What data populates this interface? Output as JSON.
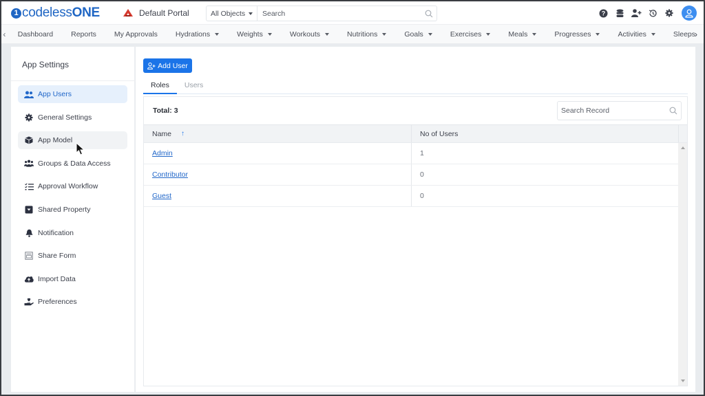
{
  "header": {
    "brand_prefix": "codeless",
    "brand_suffix": "ONE",
    "logo_mark": "1",
    "portal_icon": "portal-logo-icon",
    "portal_name": "Default Portal",
    "search_scope": "All Objects",
    "search_placeholder": "Search",
    "icons": [
      "help-icon",
      "database-icon",
      "add-user-icon",
      "history-icon",
      "gear-icon",
      "user-avatar-icon"
    ]
  },
  "nav": {
    "items": [
      {
        "label": "Dashboard",
        "dropdown": false
      },
      {
        "label": "Reports",
        "dropdown": false
      },
      {
        "label": "My Approvals",
        "dropdown": false
      },
      {
        "label": "Hydrations",
        "dropdown": true
      },
      {
        "label": "Weights",
        "dropdown": true
      },
      {
        "label": "Workouts",
        "dropdown": true
      },
      {
        "label": "Nutritions",
        "dropdown": true
      },
      {
        "label": "Goals",
        "dropdown": true
      },
      {
        "label": "Exercises",
        "dropdown": true
      },
      {
        "label": "Meals",
        "dropdown": true
      },
      {
        "label": "Progresses",
        "dropdown": true
      },
      {
        "label": "Activities",
        "dropdown": true
      },
      {
        "label": "Sleeps",
        "dropdown": false
      }
    ],
    "prev_icon": "chevron-left-icon",
    "next_icon": "chevron-right-icon"
  },
  "sidebar": {
    "title": "App Settings",
    "items": [
      {
        "label": "App Users",
        "icon": "users-icon",
        "state": "active"
      },
      {
        "label": "General Settings",
        "icon": "gear-icon",
        "state": ""
      },
      {
        "label": "App Model",
        "icon": "cube-icon",
        "state": "hover"
      },
      {
        "label": "Groups & Data Access",
        "icon": "user-group-icon",
        "state": ""
      },
      {
        "label": "Approval Workflow",
        "icon": "checklist-icon",
        "state": ""
      },
      {
        "label": "Shared Property",
        "icon": "inbox-icon",
        "state": ""
      },
      {
        "label": "Notification",
        "icon": "bell-icon",
        "state": ""
      },
      {
        "label": "Share Form",
        "icon": "form-icon",
        "state": ""
      },
      {
        "label": "Import Data",
        "icon": "cloud-upload-icon",
        "state": ""
      },
      {
        "label": "Preferences",
        "icon": "hand-heart-icon",
        "state": ""
      }
    ]
  },
  "main": {
    "add_user_label": "Add User",
    "tabs": [
      {
        "label": "Roles",
        "active": true
      },
      {
        "label": "Users",
        "active": false
      }
    ],
    "total_label": "Total: 3",
    "search_placeholder": "Search Record",
    "columns": [
      {
        "label": "Name",
        "sort": "ascending"
      },
      {
        "label": "No of Users"
      }
    ],
    "sort_glyph": "↑",
    "rows": [
      {
        "name": "Admin",
        "users": "1"
      },
      {
        "name": "Contributor",
        "users": "0"
      },
      {
        "name": "Guest",
        "users": "0"
      }
    ]
  },
  "colors": {
    "brand": "#1f66c4",
    "primary_button": "#1b74e8",
    "active_sidebar_bg": "#e6f0fc",
    "link": "#2167c9",
    "avatar": "#3d8ef0",
    "portal_icon": "#d63a2f"
  }
}
